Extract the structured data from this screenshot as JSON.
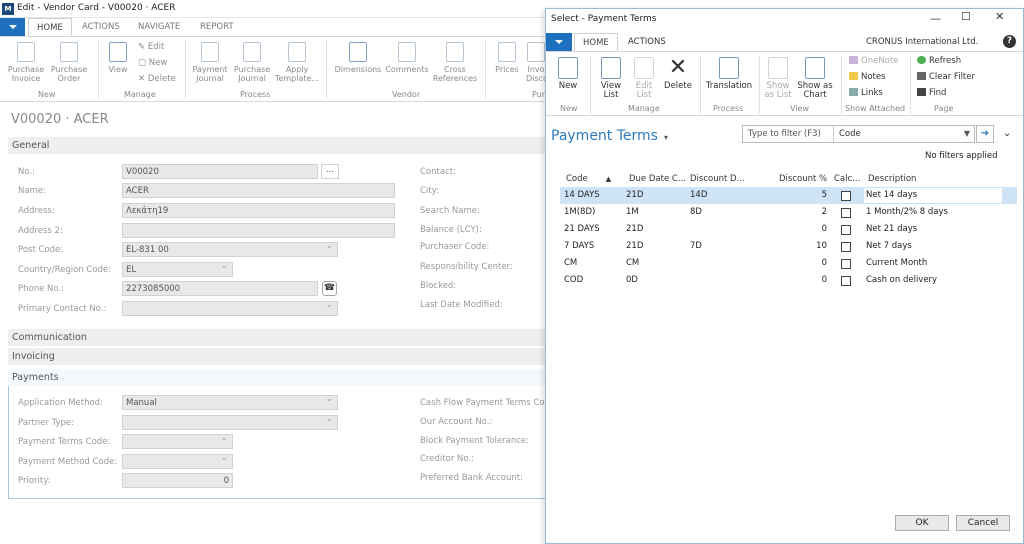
{
  "main": {
    "window_title": "Edit - Vendor Card - V00020 · ACER",
    "tabs": [
      "HOME",
      "ACTIONS",
      "NAVIGATE",
      "REPORT"
    ],
    "ribbon": {
      "purchase_invoice": "Purchase\nInvoice",
      "purchase_order": "Purchase\nOrder",
      "view": "View",
      "edit": "Edit",
      "new": "New",
      "delete": "Delete",
      "payment_journal": "Payment\nJournal",
      "purchase_journal": "Purchase\nJournal",
      "apply_template": "Apply\nTemplate...",
      "dimensions": "Dimensions",
      "comments": "Comments",
      "cross_references": "Cross\nReferences",
      "prices": "Prices",
      "inv_disc": "Invo\nDisco",
      "groups": [
        "New",
        "Manage",
        "Process",
        "Vendor",
        "Pur"
      ]
    },
    "page_title": "V00020 · ACER",
    "sections": {
      "general": "General",
      "communication": "Communication",
      "invoicing": "Invoicing",
      "payments": "Payments"
    },
    "general": {
      "no_label": "No.:",
      "no_value": "V00020",
      "name_label": "Name:",
      "name_value": "ACER",
      "address_label": "Address:",
      "address_value": "Λεκάτη19",
      "address2_label": "Address 2:",
      "address2_value": "",
      "postcode_label": "Post Code:",
      "postcode_value": "EL-831 00",
      "country_label": "Country/Region Code:",
      "country_value": "EL",
      "phone_label": "Phone No.:",
      "phone_value": "2273085000",
      "contact_no_label": "Primary Contact No.:",
      "contact_no_value": "",
      "right": [
        "Contact:",
        "City:",
        "Search Name:",
        "Balance (LCY):",
        "Purchaser Code:",
        "Responsibility Center:",
        "Blocked:",
        "Last Date Modified:"
      ]
    },
    "payments": {
      "app_method_label": "Application Method:",
      "app_method_value": "Manual",
      "partner_type_label": "Partner Type:",
      "partner_type_value": "",
      "pt_code_label": "Payment Terms Code:",
      "pt_code_value": "",
      "pm_code_label": "Payment Method Code:",
      "pm_code_value": "",
      "priority_label": "Priority:",
      "priority_value": "0",
      "right": [
        "Cash Flow Payment Terms Code:",
        "Our Account No.:",
        "Block Payment Tolerance:",
        "Creditor No.:",
        "Preferred Bank Account:"
      ]
    }
  },
  "dialog": {
    "title": "Select - Payment Terms",
    "tabs": [
      "HOME",
      "ACTIONS"
    ],
    "company": "CRONUS International Ltd.",
    "ribbon": {
      "new": "New",
      "view_list": "View\nList",
      "edit_list": "Edit\nList",
      "delete": "Delete",
      "translation": "Translation",
      "show_as_list": "Show\nas List",
      "show_as_chart": "Show as\nChart",
      "onenote": "OneNote",
      "notes": "Notes",
      "links": "Links",
      "refresh": "Refresh",
      "clear_filter": "Clear Filter",
      "find": "Find",
      "groups": [
        "New",
        "Manage",
        "Process",
        "View",
        "Show Attached",
        "Page"
      ]
    },
    "list_title": "Payment Terms",
    "filter_placeholder": "Type to filter (F3)",
    "filter_field": "Code",
    "no_filters": "No filters applied",
    "columns": [
      "Code",
      "Due Date C...",
      "Discount D...",
      "Discount %",
      "Calc...",
      "Description"
    ],
    "rows": [
      {
        "code": "14 DAYS",
        "due": "21D",
        "disc_date": "14D",
        "disc_pct": "5",
        "desc": "Net 14 days"
      },
      {
        "code": "1M(8D)",
        "due": "1M",
        "disc_date": "8D",
        "disc_pct": "2",
        "desc": "1 Month/2% 8 days"
      },
      {
        "code": "21 DAYS",
        "due": "21D",
        "disc_date": "",
        "disc_pct": "0",
        "desc": "Net 21 days"
      },
      {
        "code": "7 DAYS",
        "due": "21D",
        "disc_date": "7D",
        "disc_pct": "10",
        "desc": "Net 7 days"
      },
      {
        "code": "CM",
        "due": "CM",
        "disc_date": "",
        "disc_pct": "0",
        "desc": "Current Month"
      },
      {
        "code": "COD",
        "due": "0D",
        "disc_date": "",
        "disc_pct": "0",
        "desc": "Cash on delivery"
      }
    ],
    "ok": "OK",
    "cancel": "Cancel"
  }
}
